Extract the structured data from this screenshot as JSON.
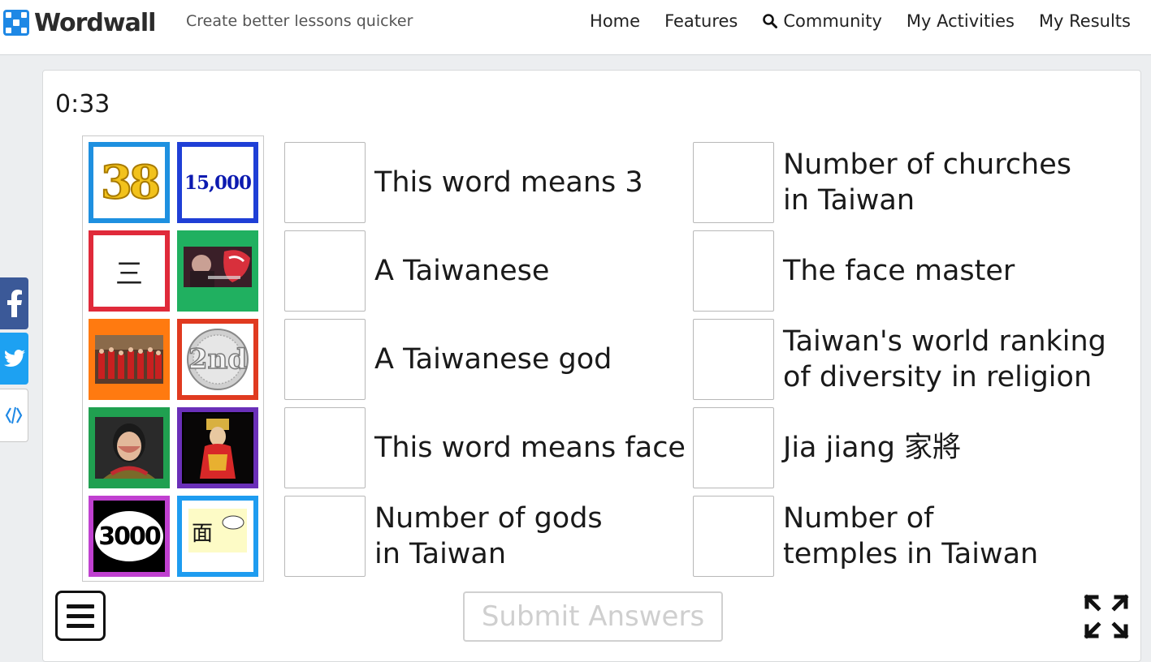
{
  "header": {
    "brand": "Wordwall",
    "tagline": "Create better lessons quicker",
    "nav": [
      "Home",
      "Features",
      "Community",
      "My Activities",
      "My Results"
    ]
  },
  "game": {
    "timer": "0:33",
    "tiles": [
      {
        "label": "38",
        "color": "#1e90e0"
      },
      {
        "label": "15,000",
        "color": "#1f3fd6"
      },
      {
        "label": "三",
        "color": "#e02a3a"
      },
      {
        "label": "",
        "color": "#20b060"
      },
      {
        "label": "",
        "color": "#ff7a10"
      },
      {
        "label": "2nd",
        "color": "#e03a20"
      },
      {
        "label": "",
        "color": "#20a050"
      },
      {
        "label": "",
        "color": "#6a2fb8"
      },
      {
        "label": "3000",
        "color": "#c040d0"
      },
      {
        "label": "面",
        "color": "#1e9cf0"
      }
    ],
    "left_clues": [
      "This word means 3",
      "A Taiwanese",
      "A Taiwanese god",
      "This word means face",
      "Number of gods in Taiwan"
    ],
    "right_clues": [
      "Number of churches in Taiwan",
      "The face master",
      "Taiwan's world ranking of diversity in religion",
      "Jia jiang 家將",
      "Number of temples in Taiwan"
    ],
    "submit_label": "Submit Answers"
  },
  "icons": {
    "social": [
      "facebook-icon",
      "twitter-icon",
      "embed-icon"
    ],
    "menu": "hamburger-icon",
    "fullscreen": "fullscreen-icon"
  }
}
